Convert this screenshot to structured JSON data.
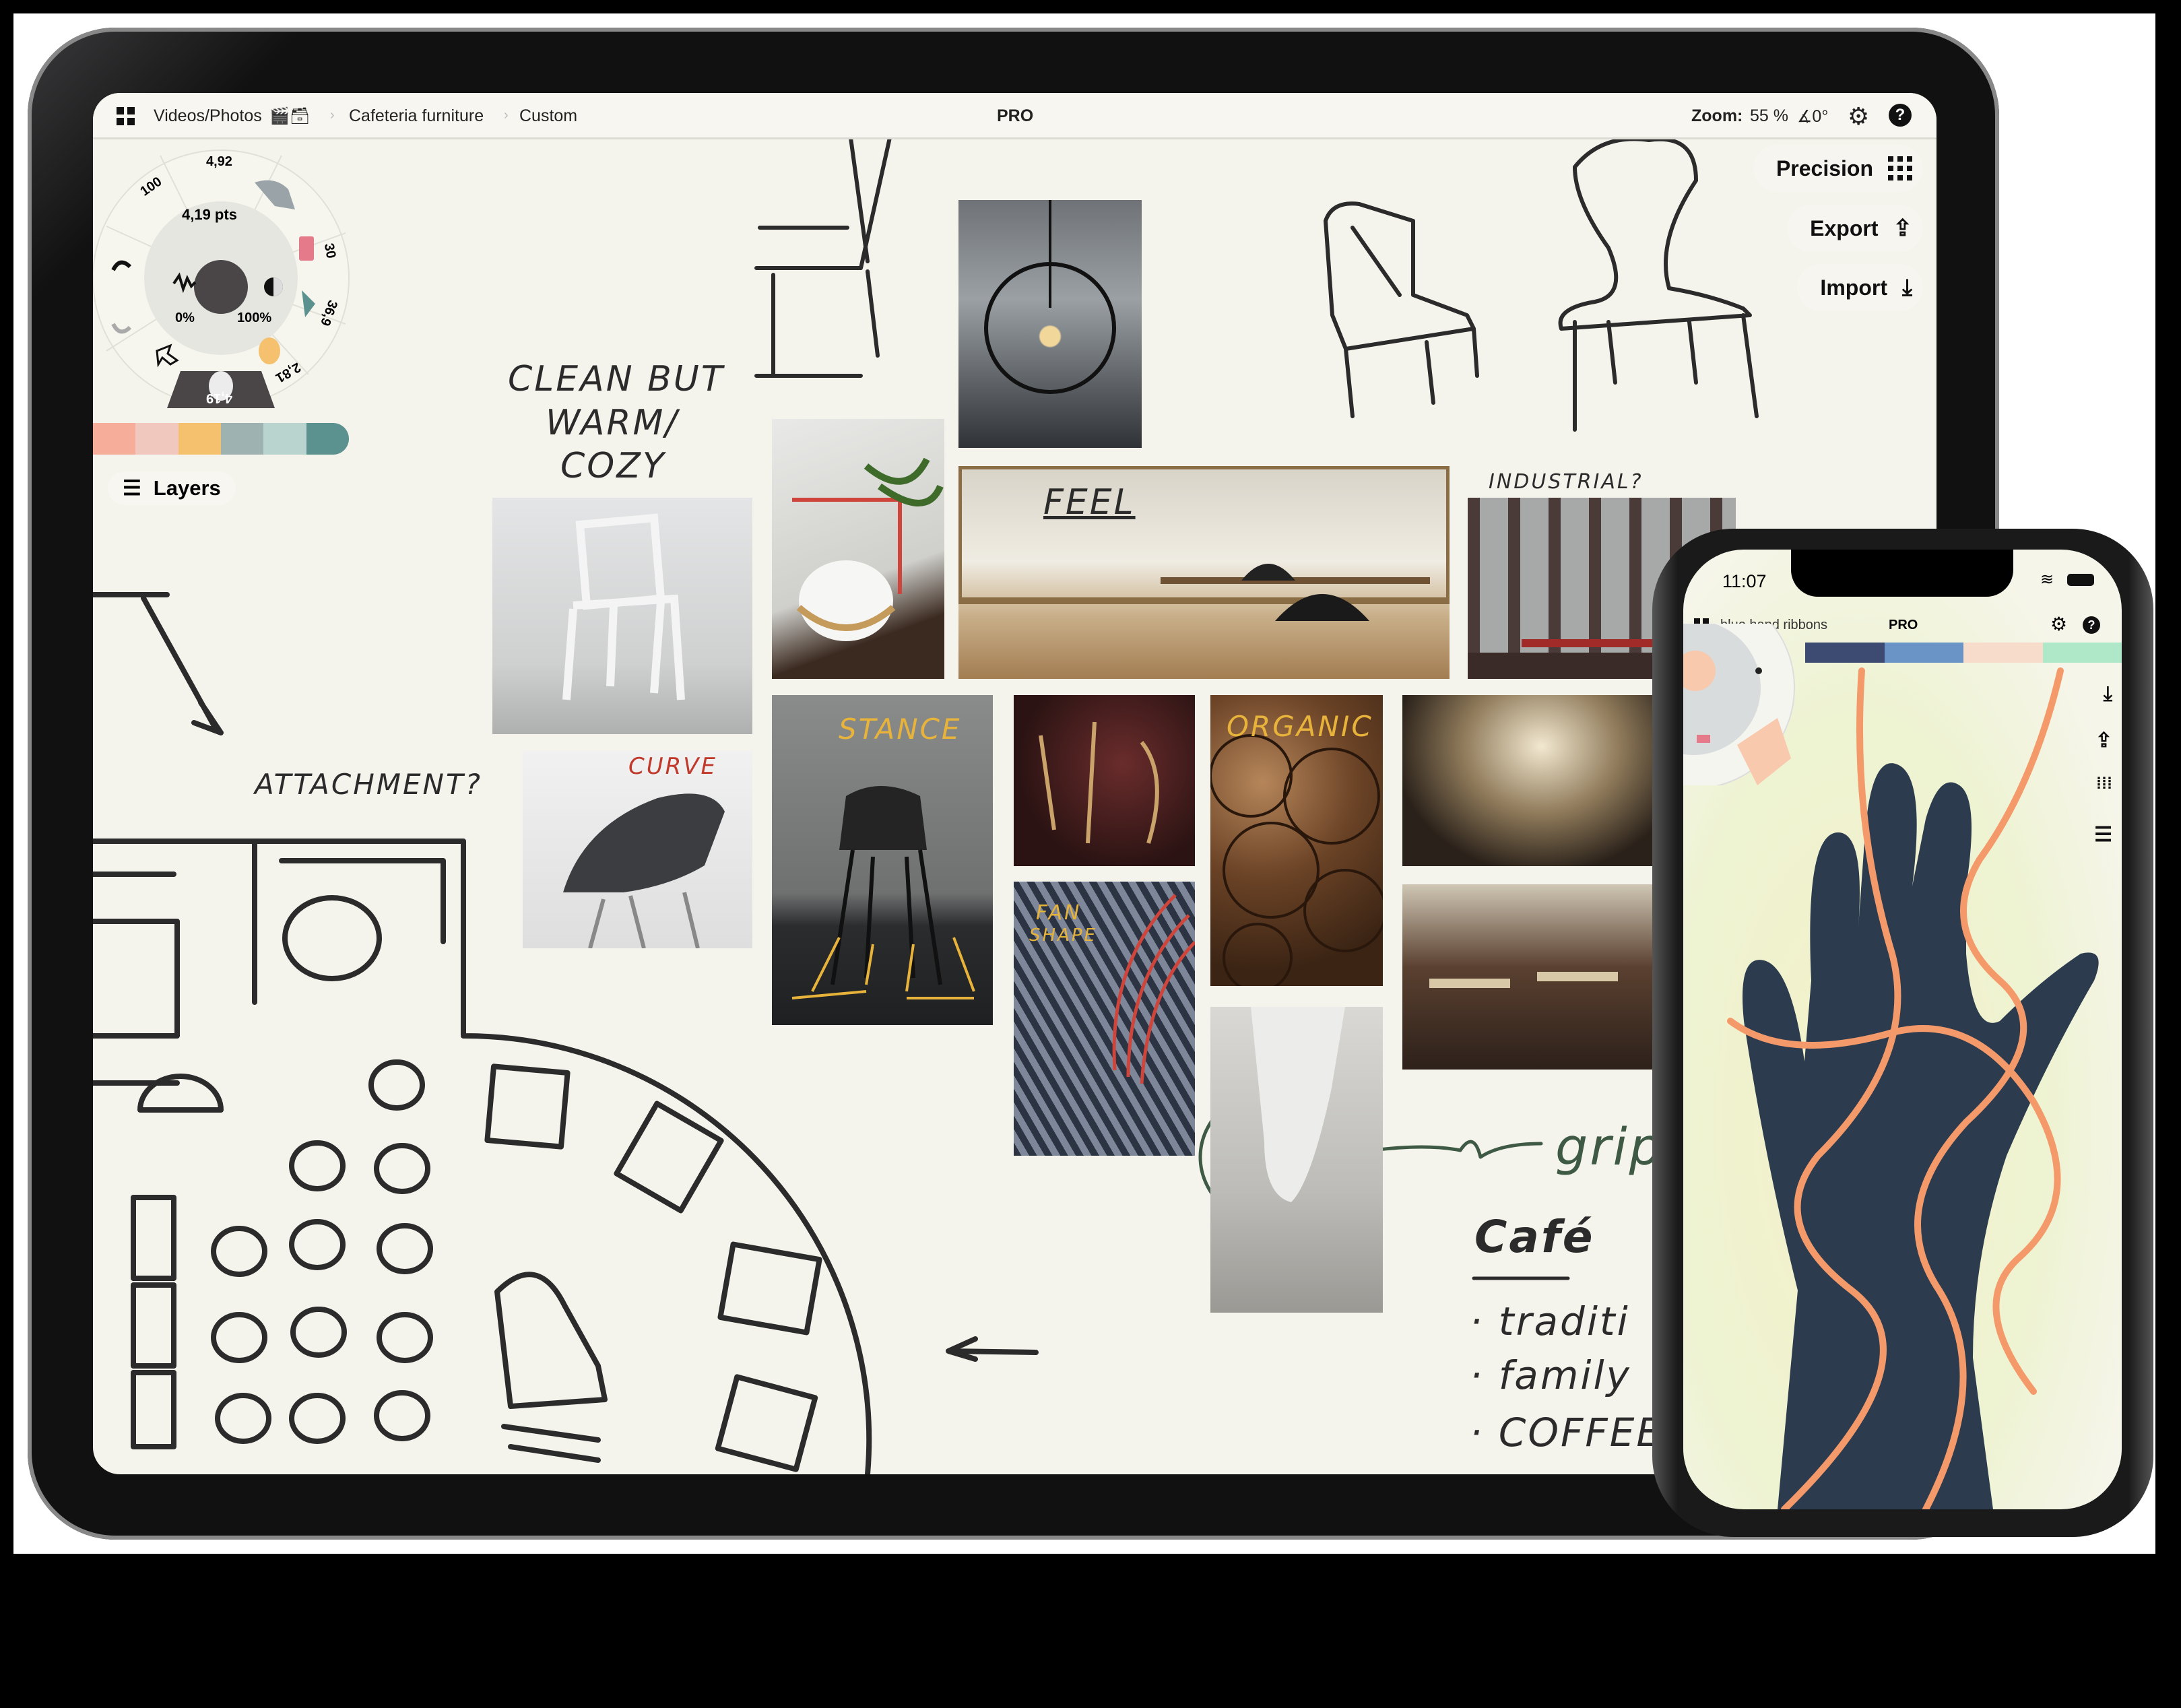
{
  "ipad": {
    "topbar": {
      "breadcrumb": [
        "Videos/Photos",
        "Cafeteria furniture",
        "Custom"
      ],
      "breadcrumb_emoji": "🎬🗃",
      "pro_label": "PRO",
      "zoom_label": "Zoom:",
      "zoom_value": "55 %",
      "rotation_value": "∡0°",
      "icons": [
        "grid-icon",
        "gear-icon",
        "help-icon"
      ]
    },
    "side_buttons": [
      {
        "label": "Precision",
        "icon": "grid-dots-icon"
      },
      {
        "label": "Export",
        "icon": "upload-icon"
      },
      {
        "label": "Import",
        "icon": "download-icon"
      }
    ],
    "tool_wheel": {
      "size": "4,19 pts",
      "smoothing": "0%",
      "opacity": "100%",
      "segments": [
        "100",
        "4,92",
        "30",
        "36,9",
        "2,81",
        "4,19"
      ],
      "active_color": "#4a4648"
    },
    "palette": [
      "#f6ad9a",
      "#f0c8bd",
      "#f5c16f",
      "#9fb2b2",
      "#b9d3cf",
      "#5b918e"
    ],
    "layers_label": "Layers",
    "handwriting": {
      "clean": "CLEAN BUT",
      "warm": "WARM/",
      "cozy": "COZY",
      "feel": "FEEL",
      "industrial": "INDUSTRIAL?",
      "stance": "STANCE",
      "curve": "CURVE",
      "organic": "ORGANIC",
      "fan": "FAN",
      "shape": "SHAPE",
      "attachment": "ATTACHMENT?",
      "grip": "grip",
      "cafe": "Café",
      "notes": [
        "· traditi",
        "· family",
        "· COFFEE"
      ]
    }
  },
  "phone": {
    "status": {
      "time": "11:07"
    },
    "topbar": {
      "breadcrumb": "blue hand ribbons",
      "pro_label": "PRO"
    },
    "palette": [
      "#3d4a72",
      "#6a93c6",
      "#f8dccb",
      "#aee8c9"
    ],
    "side_icons": [
      "download-icon",
      "upload-icon",
      "grid-dots-icon",
      "layers-icon"
    ]
  }
}
